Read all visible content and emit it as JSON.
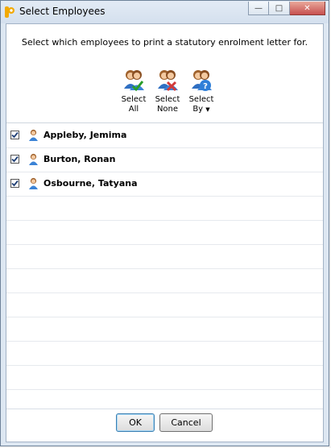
{
  "window": {
    "title": "Select Employees",
    "caption": {
      "minimize": "—",
      "maximize": "□",
      "close": "✕"
    }
  },
  "instruction": "Select which employees to print a statutory enrolment letter for.",
  "toolbar": {
    "select_all": {
      "line1": "Select",
      "line2": "All",
      "icon": "employees-check-icon"
    },
    "select_none": {
      "line1": "Select",
      "line2": "None",
      "icon": "employees-cross-icon"
    },
    "select_by": {
      "line1": "Select",
      "line2": "By",
      "arrow": "▼",
      "icon": "employees-question-icon"
    }
  },
  "employees": [
    {
      "name": "Appleby, Jemima",
      "checked": true
    },
    {
      "name": "Burton, Ronan",
      "checked": true
    },
    {
      "name": "Osbourne, Tatyana",
      "checked": true
    }
  ],
  "buttons": {
    "ok": "OK",
    "cancel": "Cancel"
  },
  "colors": {
    "accent": "#3c7fb1",
    "check": "#1f3f75",
    "close": "#c75050"
  }
}
